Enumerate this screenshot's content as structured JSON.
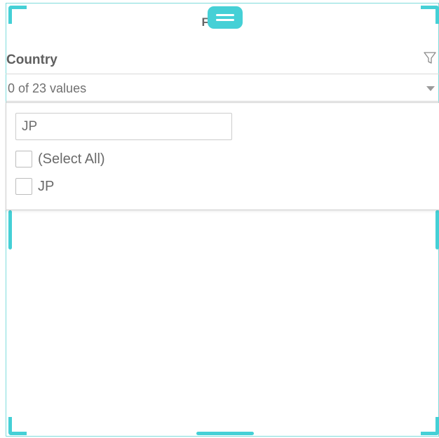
{
  "panel": {
    "title": "Filters"
  },
  "filter": {
    "label": "Country",
    "icon": "filter-funnel-icon",
    "dropdown_value": "0 of 23 values",
    "dropdown_icon": "caret-down-icon",
    "search": {
      "value": "JP"
    },
    "options": [
      {
        "label": "(Select All)",
        "checked": false
      },
      {
        "label": "JP",
        "checked": false
      }
    ]
  },
  "colors": {
    "accent": "#45d0d6",
    "border": "#7fdcdc",
    "text": "#6a6a6a"
  }
}
